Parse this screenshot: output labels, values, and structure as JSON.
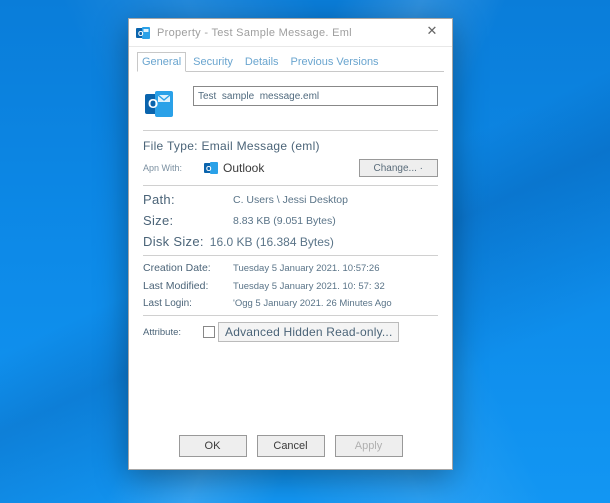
{
  "window": {
    "title": "Property - Test Sample Message. Eml",
    "close": "✕"
  },
  "tabs": {
    "general": "General",
    "security": "Security",
    "details": "Details",
    "previous": "Previous Versions"
  },
  "file": {
    "name": "Test  sample  message.eml",
    "type_label": "File Type:",
    "type_value": "Email Message (eml)"
  },
  "open_with": {
    "label": "Apn With:",
    "app": "Outlook",
    "change": "Change... ·"
  },
  "path": {
    "label": "Path:",
    "value": "C. Users \\ Jessi Desktop"
  },
  "size": {
    "label": "Size:",
    "value": "8.83 KB (9.051 Bytes)"
  },
  "disk_size": {
    "label": "Disk Size:",
    "value": "16.0 KB (16.384 Bytes)"
  },
  "created": {
    "label": "Creation Date:",
    "value": "Tuesday 5 January 2021. 10:57:26"
  },
  "modified": {
    "label": "Last Modified:",
    "value": "Tuesday 5 January 2021. 10: 57: 32"
  },
  "last_login": {
    "label": "Last Login:",
    "value": "'Ogg 5 January 2021. 26 Minutes Ago"
  },
  "attribute": {
    "label": "Attribute:",
    "text": "Advanced Hidden Read-only..."
  },
  "buttons": {
    "ok": "OK",
    "cancel": "Cancel",
    "apply": "Apply"
  }
}
